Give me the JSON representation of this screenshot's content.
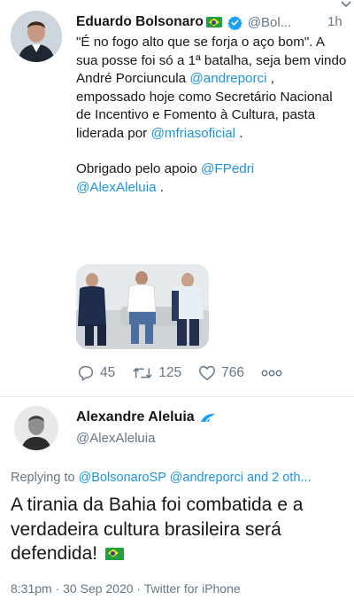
{
  "parent_tweet": {
    "author_name": "Eduardo Bolsonaro",
    "handle": "@Bol...",
    "time": "1h",
    "text": {
      "line1": "\"É no fogo alto que se forja o aço bom\". A sua posse foi só a 1ª batalha, seja bem vindo André Porciuncula ",
      "mention1": "@andreporci",
      "line2": " , empossado hoje como Secretário Nacional de Incentivo e Fomento à Cultura, pasta liderada por ",
      "mention2": "@mfriasoficial",
      "line3": " .",
      "thanks": "Obrigado pelo apoio ",
      "mention3": "@FPedri",
      "mention4": "@AlexAleluia",
      "thanks_end": " ."
    },
    "actions": {
      "replies": "45",
      "retweets": "125",
      "likes": "766"
    }
  },
  "reply_tweet": {
    "author_name": "Alexandre Aleluia",
    "handle": "@AlexAleluia",
    "replying_prefix": "Replying to ",
    "replying_to": "@BolsonaroSP @andreporci and 2 oth...",
    "text": "A tirania da Bahia foi combatida e a verdadeira cultura brasileira será defendida! ",
    "timestamp": "8:31pm · 30 Sep 2020 · Twitter for iPhone"
  },
  "colors": {
    "link": "#1b95e0",
    "muted": "#657786",
    "text": "#14171a",
    "divider": "#e6ecf0"
  },
  "icons": [
    "verified-badge-icon",
    "brazil-flag-icon",
    "chevron-down-icon",
    "reply-icon",
    "retweet-icon",
    "like-icon",
    "more-icon",
    "birdwatch-badge-icon"
  ]
}
